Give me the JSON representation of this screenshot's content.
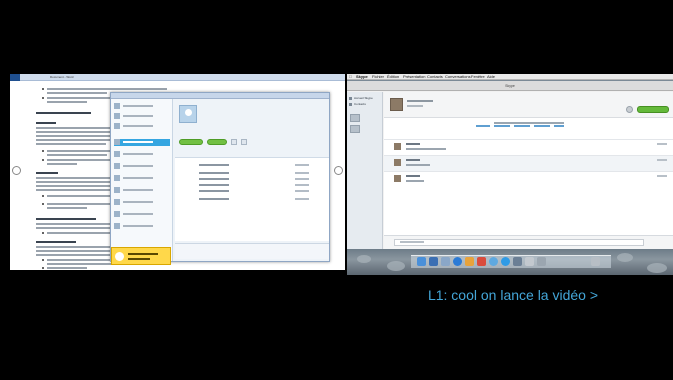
{
  "caption": "L1: cool on lance la vidéo >",
  "mac_menubar": {
    "items": [
      "Skype",
      "Fichier",
      "Édition",
      "Présentation",
      "Contacts",
      "Conversations",
      "Fenêtre",
      "Aide"
    ],
    "active_app": "Skype"
  },
  "mac_window": {
    "title": "Skype",
    "sidebar": [
      "Accueil Skype",
      "Contacts"
    ]
  },
  "win_window_title": "Document - Word",
  "colors": {
    "caption": "#44a6d8",
    "skype_green": "#72c043",
    "selection_blue": "#35a6e1",
    "notification_yellow": "#ffd84a"
  },
  "icons": [
    "windows-start-icon",
    "skype-avatar-icon",
    "video-call-icon",
    "finder-dock-icon",
    "skype-dock-icon",
    "trash-dock-icon"
  ]
}
